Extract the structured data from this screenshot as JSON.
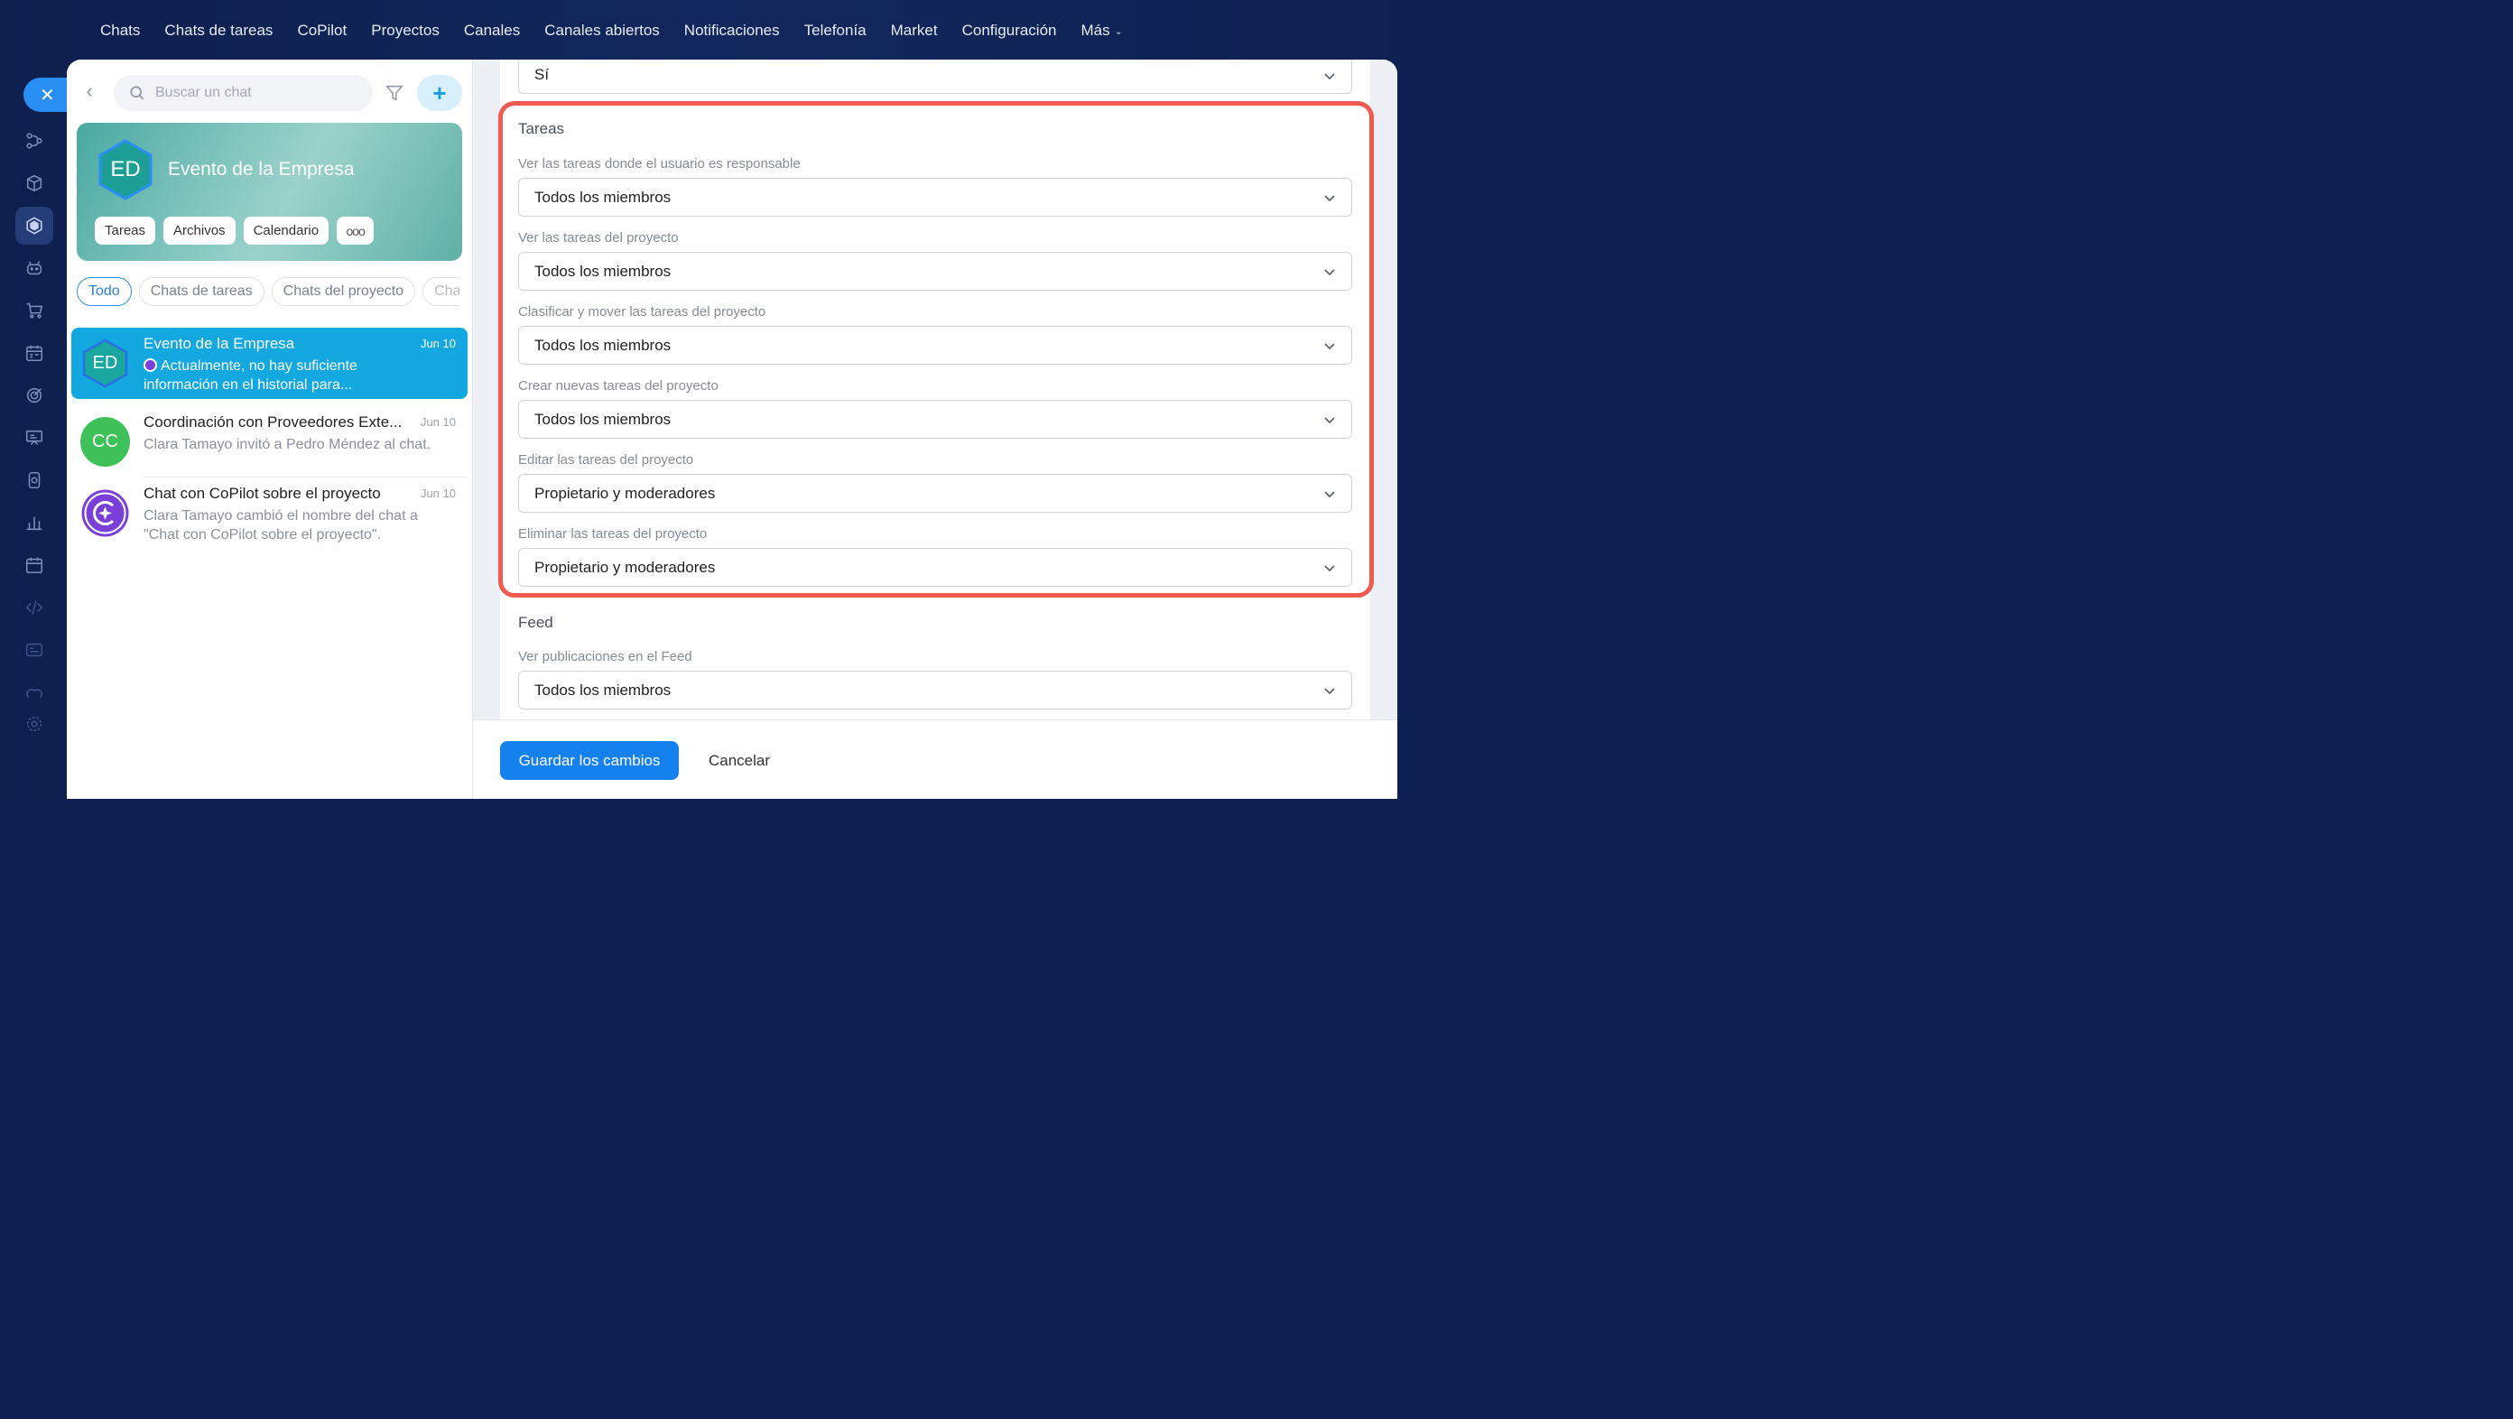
{
  "topnav": {
    "items": [
      "Chats",
      "Chats de tareas",
      "CoPilot",
      "Proyectos",
      "Canales",
      "Canales abiertos",
      "Notificaciones",
      "Telefonía",
      "Market",
      "Configuración",
      "Más"
    ]
  },
  "chatlist": {
    "search_placeholder": "Buscar un chat",
    "group": {
      "initials": "ED",
      "title": "Evento de la Empresa",
      "buttons": [
        "Tareas",
        "Archivos",
        "Calendario"
      ],
      "more_label": "ooo"
    },
    "filters": [
      "Todo",
      "Chats de tareas",
      "Chats del proyecto",
      "Cha"
    ],
    "chats": [
      {
        "initials": "ED",
        "name": "Evento de la Empresa",
        "date": "Jun 10",
        "preview": "Actualmente, no hay suficiente información en el historial para..."
      },
      {
        "initials": "CC",
        "name": "Coordinación con Proveedores Exte...",
        "date": "Jun 10",
        "preview": "Clara Tamayo invitó a Pedro Méndez al chat."
      },
      {
        "initials": "",
        "name": "Chat con CoPilot sobre el proyecto",
        "date": "Jun 10",
        "preview": "Clara Tamayo cambió el nombre del chat a \"Chat con CoPilot sobre el proyecto\"."
      }
    ]
  },
  "settings": {
    "top_select_value": "Sí",
    "tasks_section": {
      "title": "Tareas",
      "fields": [
        {
          "label": "Ver las tareas donde el usuario es responsable",
          "value": "Todos los miembros"
        },
        {
          "label": "Ver las tareas del proyecto",
          "value": "Todos los miembros"
        },
        {
          "label": "Clasificar y mover las tareas del proyecto",
          "value": "Todos los miembros"
        },
        {
          "label": "Crear nuevas tareas del proyecto",
          "value": "Todos los miembros"
        },
        {
          "label": "Editar las tareas del proyecto",
          "value": "Propietario y moderadores"
        },
        {
          "label": "Eliminar las tareas del proyecto",
          "value": "Propietario y moderadores"
        }
      ]
    },
    "feed_section": {
      "title": "Feed",
      "fields": [
        {
          "label": "Ver publicaciones en el Feed",
          "value": "Todos los miembros"
        }
      ]
    }
  },
  "footer": {
    "save_label": "Guardar los cambios",
    "cancel_label": "Cancelar"
  },
  "colors": {
    "accent": "#1481ee",
    "highlight": "#f05a4f",
    "selected_chat": "#13a8e0",
    "nav_bg": "#0f2152"
  }
}
